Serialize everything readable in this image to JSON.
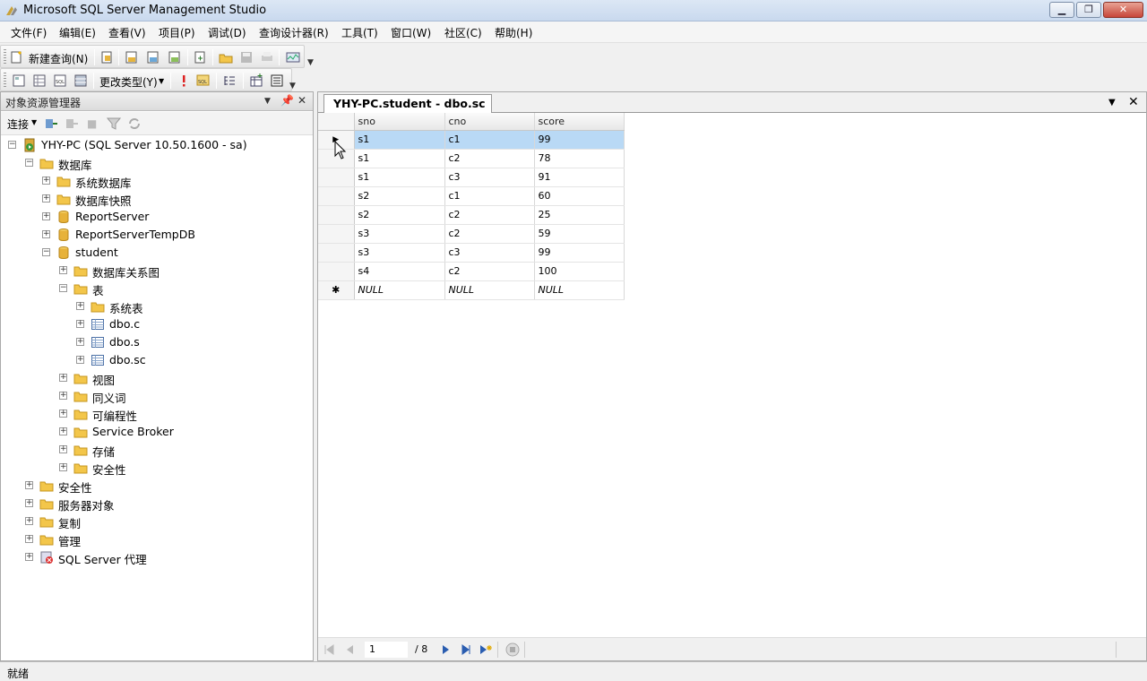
{
  "window": {
    "title": "Microsoft SQL Server Management Studio"
  },
  "menu": [
    "文件(F)",
    "编辑(E)",
    "查看(V)",
    "项目(P)",
    "调试(D)",
    "查询设计器(R)",
    "工具(T)",
    "窗口(W)",
    "社区(C)",
    "帮助(H)"
  ],
  "toolbar": {
    "new_query": "新建查询(N)",
    "change_type": "更改类型(Y)"
  },
  "object_explorer": {
    "title": "对象资源管理器",
    "connect": "连接",
    "nodes": [
      {
        "label": "YHY-PC (SQL Server 10.50.1600 - sa)",
        "icon": "server-icon",
        "expand": "-"
      },
      {
        "label": "数据库",
        "icon": "folder-icon",
        "expand": "-"
      },
      {
        "label": "系统数据库",
        "icon": "folder-icon",
        "expand": "+"
      },
      {
        "label": "数据库快照",
        "icon": "folder-icon",
        "expand": "+"
      },
      {
        "label": "ReportServer",
        "icon": "database-icon",
        "expand": "+"
      },
      {
        "label": "ReportServerTempDB",
        "icon": "database-icon",
        "expand": "+"
      },
      {
        "label": "student",
        "icon": "database-icon",
        "expand": "-"
      },
      {
        "label": "数据库关系图",
        "icon": "folder-icon",
        "expand": "+"
      },
      {
        "label": "表",
        "icon": "folder-icon",
        "expand": "-"
      },
      {
        "label": "系统表",
        "icon": "folder-icon",
        "expand": "+"
      },
      {
        "label": "dbo.c",
        "icon": "table-icon",
        "expand": "+"
      },
      {
        "label": "dbo.s",
        "icon": "table-icon",
        "expand": "+"
      },
      {
        "label": "dbo.sc",
        "icon": "table-icon",
        "expand": "+"
      },
      {
        "label": "视图",
        "icon": "folder-icon",
        "expand": "+"
      },
      {
        "label": "同义词",
        "icon": "folder-icon",
        "expand": "+"
      },
      {
        "label": "可编程性",
        "icon": "folder-icon",
        "expand": "+"
      },
      {
        "label": "Service Broker",
        "icon": "folder-icon",
        "expand": "+"
      },
      {
        "label": "存储",
        "icon": "folder-icon",
        "expand": "+"
      },
      {
        "label": "安全性",
        "icon": "folder-icon",
        "expand": "+"
      },
      {
        "label": "安全性",
        "icon": "folder-icon",
        "expand": "+"
      },
      {
        "label": "服务器对象",
        "icon": "folder-icon",
        "expand": "+"
      },
      {
        "label": "复制",
        "icon": "folder-icon",
        "expand": "+"
      },
      {
        "label": "管理",
        "icon": "folder-icon",
        "expand": "+"
      },
      {
        "label": "SQL Server 代理",
        "icon": "agent-icon",
        "expand": "+"
      }
    ]
  },
  "document": {
    "tab_title": "YHY-PC.student - dbo.sc",
    "columns": [
      "sno",
      "cno",
      "score"
    ],
    "rows": [
      [
        "s1",
        "c1",
        "99"
      ],
      [
        "s1",
        "c2",
        "78"
      ],
      [
        "s1",
        "c3",
        "91"
      ],
      [
        "s2",
        "c1",
        "60"
      ],
      [
        "s2",
        "c2",
        "25"
      ],
      [
        "s3",
        "c2",
        "59"
      ],
      [
        "s3",
        "c3",
        "99"
      ],
      [
        "s4",
        "c2",
        "100"
      ]
    ],
    "new_row": [
      "NULL",
      "NULL",
      "NULL"
    ],
    "new_row_marker": "✱",
    "current_row_marker": "▶",
    "pager": {
      "current": "1",
      "total": "/ 8"
    }
  },
  "status": {
    "text": "就绪"
  },
  "colors": {
    "selection": "#b9d9f5",
    "folder": "#f3c64a",
    "database": "#e7b23a"
  }
}
